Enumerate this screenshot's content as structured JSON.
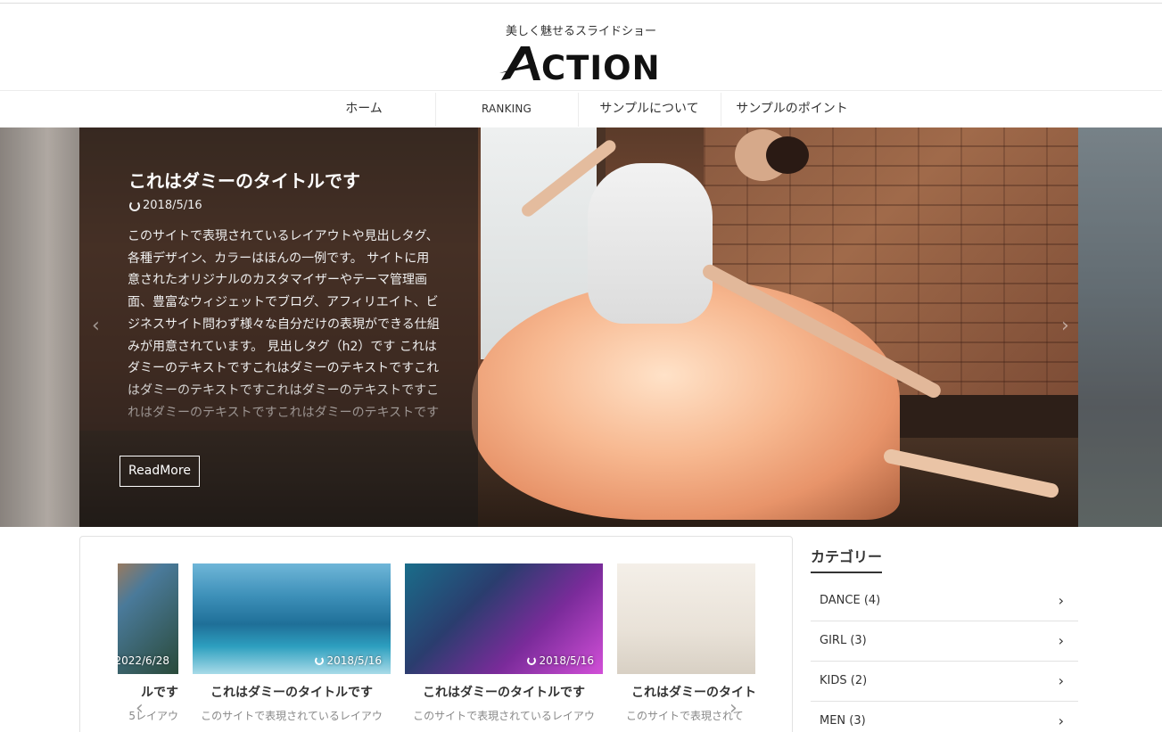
{
  "header": {
    "tagline": "美しく魅せるスライドショー",
    "logo_text": "ACTION"
  },
  "nav": {
    "items": [
      {
        "label": "ホーム"
      },
      {
        "label": "RANKING"
      },
      {
        "label": "サンプルについて"
      },
      {
        "label": "サンプルのポイント"
      }
    ]
  },
  "hero": {
    "title": "これはダミーのタイトルです",
    "date": "2018/5/16",
    "excerpt": "このサイトで表現されているレイアウトや見出しタグ、各種デザイン、カラーはほんの一例です。 サイトに用意されたオリジナルのカスタマイザーやテーマ管理画面、豊富なウィジェットでブログ、アフィリエイト、ビジネスサイト問わず様々な自分だけの表現ができる仕組みが用意されています。 見出しタグ（h2）です これはダミーのテキストですこれはダミーのテキストですこれはダミーのテキストですこれはダミーのテキストですこれはダミーのテキストですこれはダミーのテキストです",
    "readmore": "ReadMore",
    "prev_arrow": "‹",
    "next_arrow": "›"
  },
  "carousel": {
    "cards": [
      {
        "date": "2022/6/28",
        "title": "ルです",
        "excerpt": "5レイアウ"
      },
      {
        "date": "2018/5/16",
        "title": "これはダミーのタイトルです",
        "excerpt": "このサイトで表現されているレイアウ"
      },
      {
        "date": "2018/5/16",
        "title": "これはダミーのタイトルです",
        "excerpt": "このサイトで表現されているレイアウ"
      },
      {
        "date": "",
        "title": "これはダミーのタイト",
        "excerpt": "このサイトで表現されて"
      }
    ],
    "prev_arrow": "‹",
    "next_arrow": "›"
  },
  "sidebar": {
    "widget_title": "カテゴリー",
    "categories": [
      {
        "label": "DANCE (4)"
      },
      {
        "label": "GIRL (3)"
      },
      {
        "label": "KIDS (2)"
      },
      {
        "label": "MEN (3)"
      }
    ],
    "chevron": "›"
  },
  "colors": {
    "text": "#333333",
    "border": "#e2e2e2",
    "overlay": "rgba(25,25,25,0.55)"
  }
}
